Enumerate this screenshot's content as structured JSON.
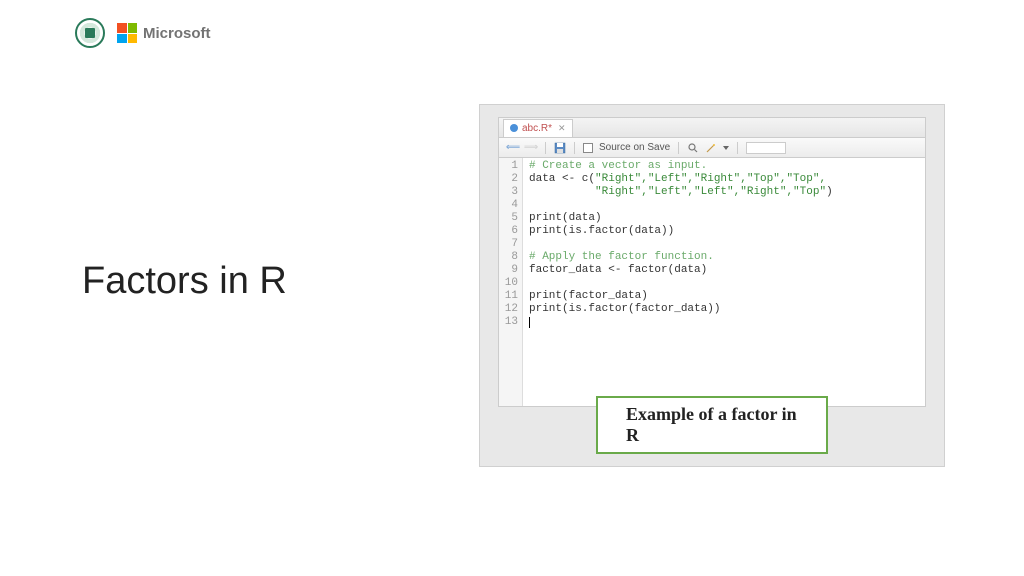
{
  "header": {
    "ms_label": "Microsoft"
  },
  "slide": {
    "title": "Factors in R"
  },
  "editor": {
    "tab_name": "abc.R*",
    "toolbar": {
      "source_on_save": "Source on Save"
    },
    "gutter": [
      "1",
      "2",
      "3",
      "4",
      "5",
      "6",
      "7",
      "8",
      "9",
      "10",
      "11",
      "12",
      "13"
    ],
    "code": {
      "l1_comment": "# Create a vector as input.",
      "l2a": "data <- c(",
      "l2b": "\"Right\",\"Left\",\"Right\",\"Top\",\"Top\",",
      "l3_indent": "          ",
      "l3": "\"Right\",\"Left\",\"Left\",\"Right\",\"Top\"",
      "l3c": ")",
      "l5": "print(data)",
      "l6": "print(is.factor(data))",
      "l8_comment": "# Apply the factor function.",
      "l9": "factor_data <- factor(data)",
      "l11": "print(factor_data)",
      "l12": "print(is.factor(factor_data))"
    }
  },
  "caption": "Example of a factor in R"
}
